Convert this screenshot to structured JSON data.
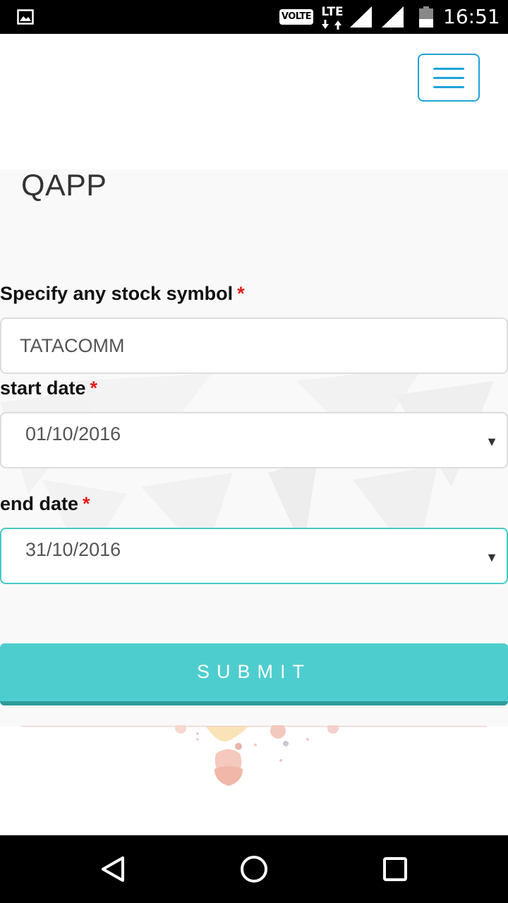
{
  "status_bar": {
    "left_icon": "image-icon",
    "volte": "VOLTE",
    "network": "LTE",
    "time": "16:51"
  },
  "header": {
    "menu_icon": "hamburger-menu-icon"
  },
  "app": {
    "title": "QAPP"
  },
  "form": {
    "symbol": {
      "label": "Specify any stock symbol",
      "required_mark": "*",
      "value": "TATACOMM"
    },
    "start_date": {
      "label": "start date",
      "required_mark": "*",
      "value": "01/10/2016",
      "caret": "▼"
    },
    "end_date": {
      "label": "end date",
      "required_mark": "*",
      "value": "31/10/2016",
      "caret": "▼"
    },
    "submit_label": "SUBMIT"
  },
  "nav": {
    "back_icon": "back-triangle-icon",
    "home_icon": "home-circle-icon",
    "recents_icon": "recents-square-icon"
  },
  "colors": {
    "accent": "#4ecdcf",
    "accent_dark": "#2e9c9c",
    "menu_blue": "#1fa3d9",
    "required": "#e31b1b",
    "panel_bg": "#f9f9f9"
  }
}
